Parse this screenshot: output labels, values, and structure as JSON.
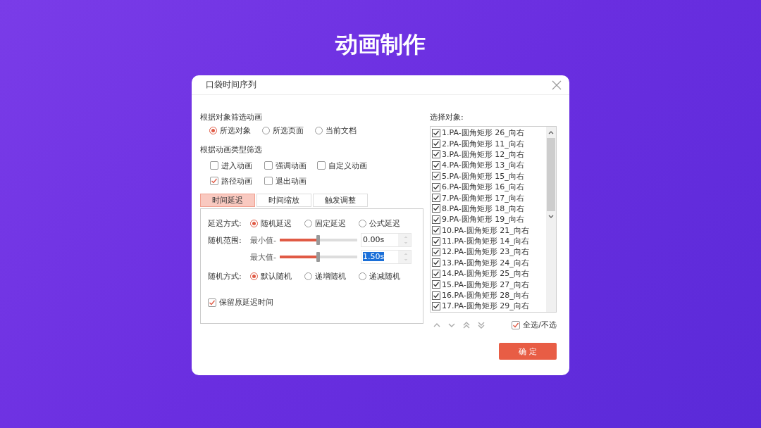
{
  "slide_title": "动画制作",
  "dialog": {
    "title": "口袋时间序列",
    "object_filter": {
      "label": "根据对象筛选动画",
      "options": [
        {
          "label": "所选对象",
          "selected": true
        },
        {
          "label": "所选页面",
          "selected": false
        },
        {
          "label": "当前文档",
          "selected": false
        }
      ]
    },
    "type_filter": {
      "label": "根据动画类型筛选",
      "options": [
        {
          "label": "进入动画",
          "checked": false
        },
        {
          "label": "强调动画",
          "checked": false
        },
        {
          "label": "自定义动画",
          "checked": false
        },
        {
          "label": "路径动画",
          "checked": true
        },
        {
          "label": "退出动画",
          "checked": false
        }
      ]
    },
    "tabs": [
      {
        "label": "时间延迟",
        "selected": true
      },
      {
        "label": "时间缩放",
        "selected": false
      },
      {
        "label": "触发调整",
        "selected": false
      }
    ],
    "delay_mode": {
      "label": "延迟方式:",
      "options": [
        {
          "label": "随机延迟",
          "selected": true
        },
        {
          "label": "固定延迟",
          "selected": false
        },
        {
          "label": "公式延迟",
          "selected": false
        }
      ]
    },
    "random_range": {
      "label": "随机范围:",
      "min": {
        "label": "最小值-",
        "level": 0.5,
        "value": "0.00s",
        "highlighted": false
      },
      "max": {
        "label": "最大值-",
        "level": 0.5,
        "value": "1.50s",
        "highlighted": true
      }
    },
    "random_mode": {
      "label": "随机方式:",
      "options": [
        {
          "label": "默认随机",
          "selected": true
        },
        {
          "label": "递增随机",
          "selected": false
        },
        {
          "label": "递减随机",
          "selected": false
        }
      ]
    },
    "keep_original": {
      "label": "保留原延迟时间",
      "checked": true
    },
    "objects": {
      "label": "选择对象:",
      "items": [
        {
          "label": "1.PA-圆角矩形 26_向右",
          "checked": true
        },
        {
          "label": "2.PA-圆角矩形 11_向右",
          "checked": true
        },
        {
          "label": "3.PA-圆角矩形 12_向右",
          "checked": true
        },
        {
          "label": "4.PA-圆角矩形 13_向右",
          "checked": true
        },
        {
          "label": "5.PA-圆角矩形 15_向右",
          "checked": true
        },
        {
          "label": "6.PA-圆角矩形 16_向右",
          "checked": true
        },
        {
          "label": "7.PA-圆角矩形 17_向右",
          "checked": true
        },
        {
          "label": "8.PA-圆角矩形 18_向右",
          "checked": true
        },
        {
          "label": "9.PA-圆角矩形 19_向右",
          "checked": true
        },
        {
          "label": "10.PA-圆角矩形 21_向右",
          "checked": true
        },
        {
          "label": "11.PA-圆角矩形 14_向右",
          "checked": true
        },
        {
          "label": "12.PA-圆角矩形 23_向右",
          "checked": true
        },
        {
          "label": "13.PA-圆角矩形 24_向右",
          "checked": true
        },
        {
          "label": "14.PA-圆角矩形 25_向右",
          "checked": true
        },
        {
          "label": "15.PA-圆角矩形 27_向右",
          "checked": true
        },
        {
          "label": "16.PA-圆角矩形 28_向右",
          "checked": true
        },
        {
          "label": "17.PA-圆角矩形 29_向右",
          "checked": true
        }
      ],
      "select_all": {
        "label": "全选/不选",
        "checked": true
      }
    },
    "ok_button": "确 定"
  }
}
